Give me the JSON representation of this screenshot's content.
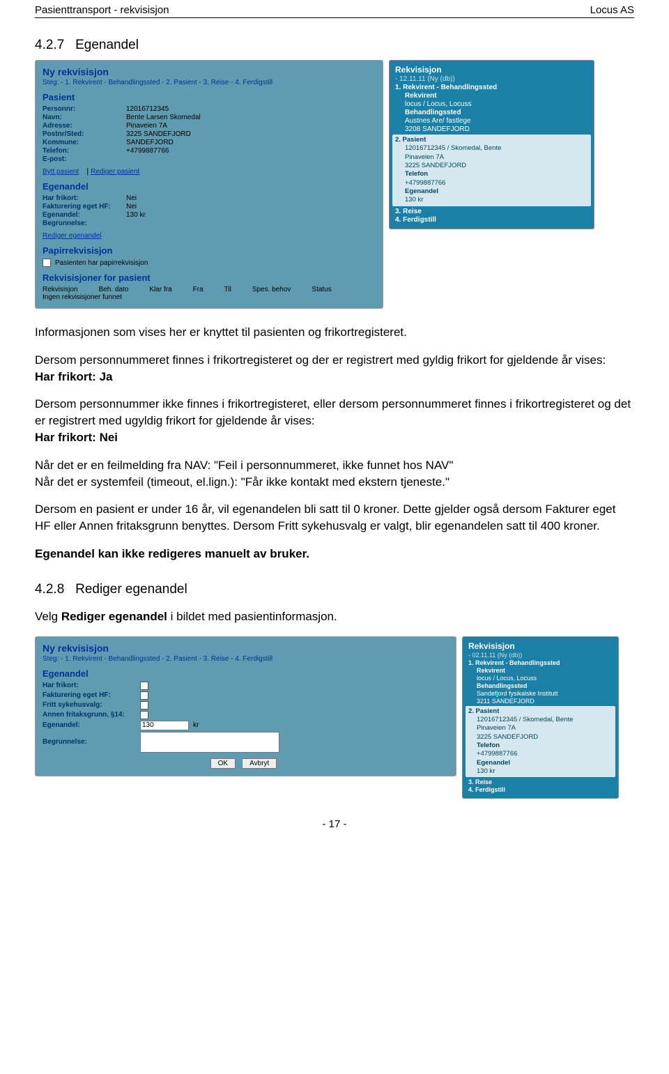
{
  "header": {
    "left": "Pasienttransport - rekvisisjon",
    "right": "Locus AS"
  },
  "section1": {
    "num": "4.2.7",
    "title": "Egenandel"
  },
  "shot1": {
    "title": "Ny rekvisisjon",
    "steps": "Steg: - 1. Rekvirent - Behandlingssted - 2. Pasient - 3. Reise - 4. Ferdigstill",
    "pasient_title": "Pasient",
    "pasient": {
      "personnr_k": "Personnr:",
      "personnr_v": "12016712345",
      "navn_k": "Navn:",
      "navn_v": "Bente Larsen Skomedal",
      "adresse_k": "Adresse:",
      "adresse_v": "Pinaveien 7A",
      "post_k": "Postnr/Sted:",
      "post_v": "3225 SANDEFJORD",
      "kommune_k": "Kommune:",
      "kommune_v": "SANDEFJORD",
      "telefon_k": "Telefon:",
      "telefon_v": "+4799887766",
      "epost_k": "E-post:",
      "epost_v": ""
    },
    "link_bytt": "Bytt pasient",
    "link_rediger": "Rediger pasient",
    "egenandel_title": "Egenandel",
    "egenandel": {
      "frikort_k": "Har frikort:",
      "frikort_v": "Nei",
      "fakt_k": "Fakturering eget HF:",
      "fakt_v": "Nei",
      "egen_k": "Egenandel:",
      "egen_v": "130 kr",
      "begr_k": "Begrunnelse:",
      "begr_v": ""
    },
    "link_red_eg": "Rediger egenandel",
    "papir_title": "Papirrekvisisjon",
    "papir_chk": "Pasienten har papirrekvisisjon",
    "rekfor_title": "Rekvisisjoner for pasient",
    "tbl_h": [
      "Rekvisisjon",
      "Beh. dato",
      "Klar fra",
      "Fra",
      "Til",
      "Spes. behov",
      "Status"
    ],
    "tbl_empty": "Ingen rekvisisjoner funnet",
    "right": {
      "title": "Rekvisisjon",
      "date": "- 12.11.11 (Ny (db))",
      "s1": "1.   Rekvirent - Behandlingssted",
      "rekvirent_h": "Rekvirent",
      "rekvirent_v": "locus / Locus, Locuss",
      "beh_h": "Behandlingssted",
      "beh_v1": "Austnes Are/ fastlege",
      "beh_v2": "3208 SANDEFJORD",
      "s2": "2.   Pasient",
      "p_line1": "12016712345 / Skomedal, Bente",
      "p_line2": "Pinaveien 7A",
      "p_line3": "3225 SANDEFJORD",
      "p_tel_h": "Telefon",
      "p_tel_v": "+4799887766",
      "p_eg_h": "Egenandel",
      "p_eg_v": "130 kr",
      "s3": "3.   Reise",
      "s4": "4.   Ferdigstill"
    }
  },
  "p1": "Informasjonen som vises her er knyttet til pasienten og frikortregisteret.",
  "p2": "Dersom personnummeret finnes i frikortregisteret og der er registrert med gyldig frikort for gjeldende år vises:",
  "p2b": "Har frikort: Ja",
  "p3": "Dersom personnummer ikke finnes i frikortregisteret, eller dersom personnummeret finnes i frikortregisteret og det er registrert med ugyldig frikort for gjeldende år vises:",
  "p3b": "Har frikort: Nei",
  "p4a": "Når det er en feilmelding fra NAV: \"Feil i personnummeret, ikke funnet hos NAV\"",
  "p4b": "Når det er systemfeil (timeout, el.lign.): \"Får ikke kontakt med ekstern tjeneste.\"",
  "p5": "Dersom en pasient er under 16 år, vil egenandelen bli satt til 0 kroner. Dette gjelder også dersom Fakturer eget HF eller Annen fritaksgrunn benyttes. Dersom Fritt sykehusvalg er valgt, blir egenandelen satt til 400 kroner.",
  "p6": "Egenandel kan ikke redigeres manuelt av bruker.",
  "section2": {
    "num": "4.2.8",
    "title": "Rediger egenandel"
  },
  "p7a": "Velg ",
  "p7b": "Rediger egenandel",
  "p7c": " i bildet med pasientinformasjon.",
  "shot2": {
    "title": "Ny rekvisisjon",
    "steps": "Steg: - 1. Rekvirent - Behandlingssted - 2. Pasient - 3. Reise - 4. Ferdigstill",
    "eg_title": "Egenandel",
    "rows": {
      "frikort": "Har frikort:",
      "fakt": "Fakturering eget HF:",
      "fritt": "Fritt sykehusvalg:",
      "annen": "Annen fritaksgrunn, §14:",
      "egen": "Egenandel:",
      "egen_v": "130",
      "egen_suffix": "kr",
      "begr": "Begrunnelse:"
    },
    "ok": "OK",
    "avbryt": "Avbryt",
    "right": {
      "title": "Rekvisisjon",
      "date": "- 02.11.11 (Ny (db))",
      "s1": "1.   Rekvirent - Behandlingssted",
      "rekvirent_h": "Rekvirent",
      "rekvirent_v": "locus / Locus, Locuss",
      "beh_h": "Behandlingssted",
      "beh_v1": "Sandefjord fysikalske Institutt",
      "beh_v2": "3211 SANDEFJORD",
      "s2": "2.   Pasient",
      "p_line1": "12016712345 / Skomedal, Bente",
      "p_line2": "Pinaveien 7A",
      "p_line3": "3225 SANDEFJORD",
      "p_tel_h": "Telefon",
      "p_tel_v": "+4799887766",
      "p_eg_h": "Egenandel",
      "p_eg_v": "130 kr",
      "s3": "3.   Reise",
      "s4": "4.   Ferdigstill"
    }
  },
  "pagenum": "- 17 -"
}
